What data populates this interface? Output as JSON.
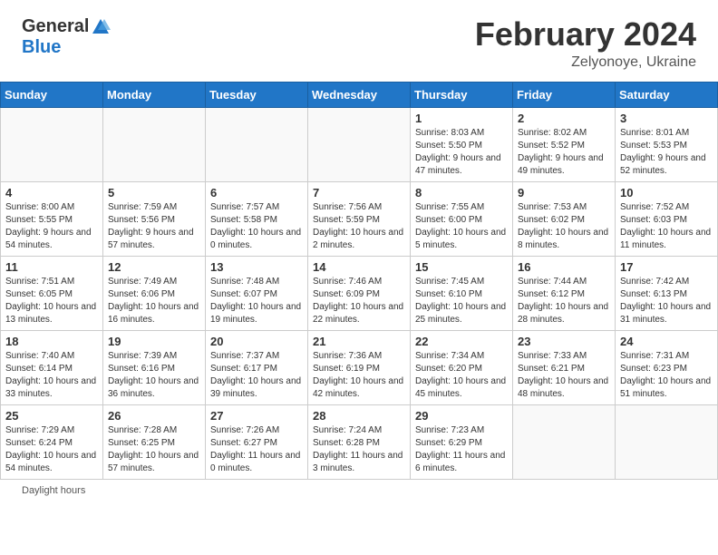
{
  "header": {
    "logo_general": "General",
    "logo_blue": "Blue",
    "month_title": "February 2024",
    "location": "Zelyonoye, Ukraine"
  },
  "days_of_week": [
    "Sunday",
    "Monday",
    "Tuesday",
    "Wednesday",
    "Thursday",
    "Friday",
    "Saturday"
  ],
  "weeks": [
    [
      {
        "day": "",
        "info": ""
      },
      {
        "day": "",
        "info": ""
      },
      {
        "day": "",
        "info": ""
      },
      {
        "day": "",
        "info": ""
      },
      {
        "day": "1",
        "info": "Sunrise: 8:03 AM\nSunset: 5:50 PM\nDaylight: 9 hours and 47 minutes."
      },
      {
        "day": "2",
        "info": "Sunrise: 8:02 AM\nSunset: 5:52 PM\nDaylight: 9 hours and 49 minutes."
      },
      {
        "day": "3",
        "info": "Sunrise: 8:01 AM\nSunset: 5:53 PM\nDaylight: 9 hours and 52 minutes."
      }
    ],
    [
      {
        "day": "4",
        "info": "Sunrise: 8:00 AM\nSunset: 5:55 PM\nDaylight: 9 hours and 54 minutes."
      },
      {
        "day": "5",
        "info": "Sunrise: 7:59 AM\nSunset: 5:56 PM\nDaylight: 9 hours and 57 minutes."
      },
      {
        "day": "6",
        "info": "Sunrise: 7:57 AM\nSunset: 5:58 PM\nDaylight: 10 hours and 0 minutes."
      },
      {
        "day": "7",
        "info": "Sunrise: 7:56 AM\nSunset: 5:59 PM\nDaylight: 10 hours and 2 minutes."
      },
      {
        "day": "8",
        "info": "Sunrise: 7:55 AM\nSunset: 6:00 PM\nDaylight: 10 hours and 5 minutes."
      },
      {
        "day": "9",
        "info": "Sunrise: 7:53 AM\nSunset: 6:02 PM\nDaylight: 10 hours and 8 minutes."
      },
      {
        "day": "10",
        "info": "Sunrise: 7:52 AM\nSunset: 6:03 PM\nDaylight: 10 hours and 11 minutes."
      }
    ],
    [
      {
        "day": "11",
        "info": "Sunrise: 7:51 AM\nSunset: 6:05 PM\nDaylight: 10 hours and 13 minutes."
      },
      {
        "day": "12",
        "info": "Sunrise: 7:49 AM\nSunset: 6:06 PM\nDaylight: 10 hours and 16 minutes."
      },
      {
        "day": "13",
        "info": "Sunrise: 7:48 AM\nSunset: 6:07 PM\nDaylight: 10 hours and 19 minutes."
      },
      {
        "day": "14",
        "info": "Sunrise: 7:46 AM\nSunset: 6:09 PM\nDaylight: 10 hours and 22 minutes."
      },
      {
        "day": "15",
        "info": "Sunrise: 7:45 AM\nSunset: 6:10 PM\nDaylight: 10 hours and 25 minutes."
      },
      {
        "day": "16",
        "info": "Sunrise: 7:44 AM\nSunset: 6:12 PM\nDaylight: 10 hours and 28 minutes."
      },
      {
        "day": "17",
        "info": "Sunrise: 7:42 AM\nSunset: 6:13 PM\nDaylight: 10 hours and 31 minutes."
      }
    ],
    [
      {
        "day": "18",
        "info": "Sunrise: 7:40 AM\nSunset: 6:14 PM\nDaylight: 10 hours and 33 minutes."
      },
      {
        "day": "19",
        "info": "Sunrise: 7:39 AM\nSunset: 6:16 PM\nDaylight: 10 hours and 36 minutes."
      },
      {
        "day": "20",
        "info": "Sunrise: 7:37 AM\nSunset: 6:17 PM\nDaylight: 10 hours and 39 minutes."
      },
      {
        "day": "21",
        "info": "Sunrise: 7:36 AM\nSunset: 6:19 PM\nDaylight: 10 hours and 42 minutes."
      },
      {
        "day": "22",
        "info": "Sunrise: 7:34 AM\nSunset: 6:20 PM\nDaylight: 10 hours and 45 minutes."
      },
      {
        "day": "23",
        "info": "Sunrise: 7:33 AM\nSunset: 6:21 PM\nDaylight: 10 hours and 48 minutes."
      },
      {
        "day": "24",
        "info": "Sunrise: 7:31 AM\nSunset: 6:23 PM\nDaylight: 10 hours and 51 minutes."
      }
    ],
    [
      {
        "day": "25",
        "info": "Sunrise: 7:29 AM\nSunset: 6:24 PM\nDaylight: 10 hours and 54 minutes."
      },
      {
        "day": "26",
        "info": "Sunrise: 7:28 AM\nSunset: 6:25 PM\nDaylight: 10 hours and 57 minutes."
      },
      {
        "day": "27",
        "info": "Sunrise: 7:26 AM\nSunset: 6:27 PM\nDaylight: 11 hours and 0 minutes."
      },
      {
        "day": "28",
        "info": "Sunrise: 7:24 AM\nSunset: 6:28 PM\nDaylight: 11 hours and 3 minutes."
      },
      {
        "day": "29",
        "info": "Sunrise: 7:23 AM\nSunset: 6:29 PM\nDaylight: 11 hours and 6 minutes."
      },
      {
        "day": "",
        "info": ""
      },
      {
        "day": "",
        "info": ""
      }
    ]
  ],
  "footer": {
    "daylight_hours_label": "Daylight hours"
  }
}
